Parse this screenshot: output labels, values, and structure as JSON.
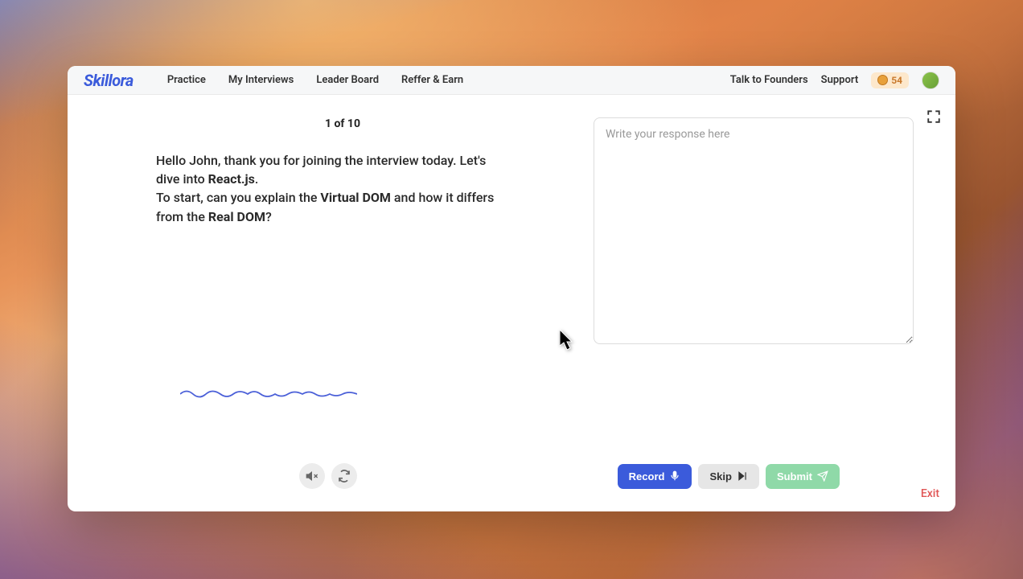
{
  "header": {
    "logo": "Skillora",
    "nav": {
      "practice": "Practice",
      "my_interviews": "My Interviews",
      "leader_board": "Leader Board",
      "reffer_earn": "Reffer & Earn"
    },
    "right": {
      "talk_to_founders": "Talk to Founders",
      "support": "Support",
      "coin_count": "54"
    }
  },
  "interview": {
    "progress": "1 of 10",
    "question": {
      "greeting_before": "Hello John, thank you for joining the interview today. Let's dive into ",
      "topic_bold": "React.js",
      "greeting_after": ".",
      "prompt_before": "To start, can you explain the ",
      "term1_bold": "Virtual DOM",
      "prompt_mid": " and how it differs from the ",
      "term2_bold": "Real DOM",
      "prompt_after": "?"
    },
    "response_placeholder": "Write your response here",
    "response_value": ""
  },
  "buttons": {
    "record": "Record",
    "skip": "Skip",
    "submit": "Submit"
  },
  "footer": {
    "exit": "Exit"
  }
}
